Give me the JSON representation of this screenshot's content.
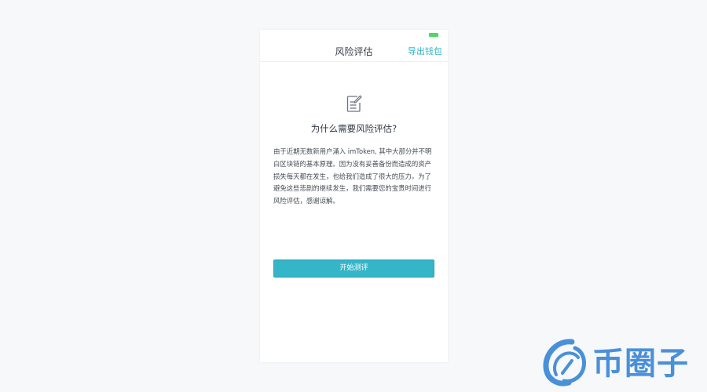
{
  "nav": {
    "title": "风险评估",
    "action_label": "导出钱包"
  },
  "content": {
    "icon": "document-edit-icon",
    "question": "为什么需要风险评估?",
    "description": "由于近期无数新用户涌入 imToken, 其中大部分并不明白区块链的基本原理。因为没有妥善备份而造成的资产损失每天都在发生，也给我们造成了很大的压力。为了避免这些悲剧的继续发生，我们需要您的宝贵时间进行风险评估，感谢谅解。"
  },
  "actions": {
    "start_label": "开始测评"
  },
  "watermark": {
    "text": "币圈子",
    "icon": "bqz-logo-icon"
  },
  "colors": {
    "accent": "#35b6c8",
    "battery": "#4cd964",
    "watermark": "#4a90d9"
  }
}
